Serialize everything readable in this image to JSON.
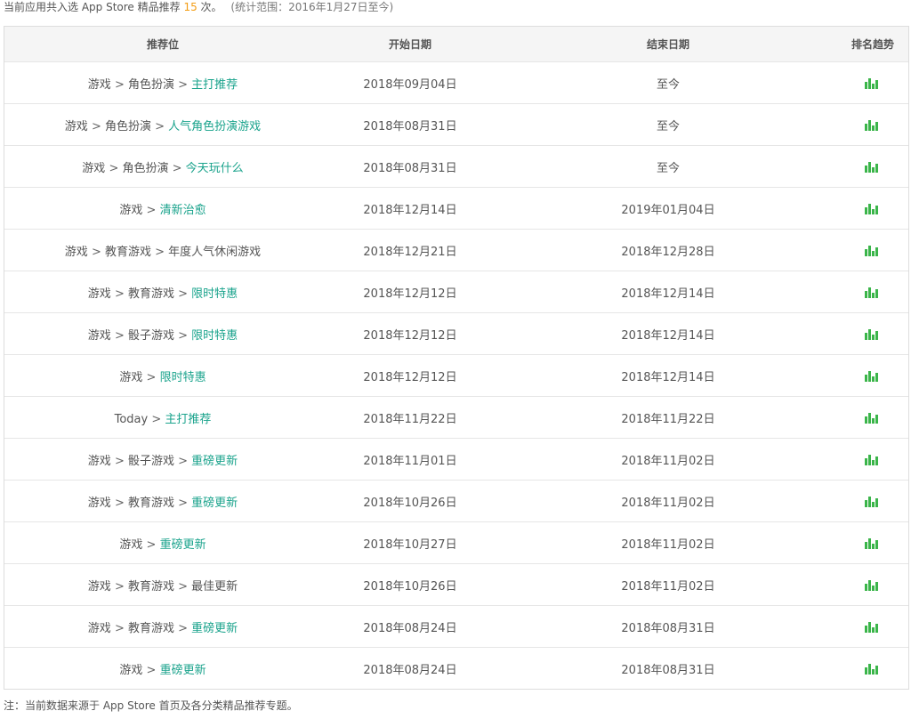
{
  "summary": {
    "prefix": "当前应用共入选 App Store 精品推荐",
    "count": "15",
    "suffix": "次。",
    "range": "(统计范围：2016年1月27日至今)"
  },
  "table": {
    "headers": [
      "推荐位",
      "开始日期",
      "结束日期",
      "排名趋势"
    ],
    "trend_icon": "bar-chart-icon",
    "trend_color": "#3bb54a",
    "link_color": "#1aa38c",
    "rows": [
      {
        "parts": [
          "游戏",
          "角色扮演"
        ],
        "leaf": "主打推荐",
        "leaf_link": true,
        "start": "2018年09月04日",
        "end": "至今"
      },
      {
        "parts": [
          "游戏",
          "角色扮演"
        ],
        "leaf": "人气角色扮演游戏",
        "leaf_link": true,
        "start": "2018年08月31日",
        "end": "至今"
      },
      {
        "parts": [
          "游戏",
          "角色扮演"
        ],
        "leaf": "今天玩什么",
        "leaf_link": true,
        "start": "2018年08月31日",
        "end": "至今"
      },
      {
        "parts": [
          "游戏"
        ],
        "leaf": "清新治愈",
        "leaf_link": true,
        "start": "2018年12月14日",
        "end": "2019年01月04日"
      },
      {
        "parts": [
          "游戏",
          "教育游戏"
        ],
        "leaf": "年度人气休闲游戏",
        "leaf_link": false,
        "start": "2018年12月21日",
        "end": "2018年12月28日"
      },
      {
        "parts": [
          "游戏",
          "教育游戏"
        ],
        "leaf": "限时特惠",
        "leaf_link": true,
        "start": "2018年12月12日",
        "end": "2018年12月14日"
      },
      {
        "parts": [
          "游戏",
          "骰子游戏"
        ],
        "leaf": "限时特惠",
        "leaf_link": true,
        "start": "2018年12月12日",
        "end": "2018年12月14日"
      },
      {
        "parts": [
          "游戏"
        ],
        "leaf": "限时特惠",
        "leaf_link": true,
        "start": "2018年12月12日",
        "end": "2018年12月14日"
      },
      {
        "parts": [
          "Today"
        ],
        "leaf": "主打推荐",
        "leaf_link": true,
        "start": "2018年11月22日",
        "end": "2018年11月22日"
      },
      {
        "parts": [
          "游戏",
          "骰子游戏"
        ],
        "leaf": "重磅更新",
        "leaf_link": true,
        "start": "2018年11月01日",
        "end": "2018年11月02日"
      },
      {
        "parts": [
          "游戏",
          "教育游戏"
        ],
        "leaf": "重磅更新",
        "leaf_link": true,
        "start": "2018年10月26日",
        "end": "2018年11月02日"
      },
      {
        "parts": [
          "游戏"
        ],
        "leaf": "重磅更新",
        "leaf_link": true,
        "start": "2018年10月27日",
        "end": "2018年11月02日"
      },
      {
        "parts": [
          "游戏",
          "教育游戏"
        ],
        "leaf": "最佳更新",
        "leaf_link": false,
        "start": "2018年10月26日",
        "end": "2018年11月02日"
      },
      {
        "parts": [
          "游戏",
          "教育游戏"
        ],
        "leaf": "重磅更新",
        "leaf_link": true,
        "start": "2018年08月24日",
        "end": "2018年08月31日"
      },
      {
        "parts": [
          "游戏"
        ],
        "leaf": "重磅更新",
        "leaf_link": true,
        "start": "2018年08月24日",
        "end": "2018年08月31日"
      }
    ]
  },
  "note": "注：当前数据来源于 App Store 首页及各分类精品推荐专题。"
}
